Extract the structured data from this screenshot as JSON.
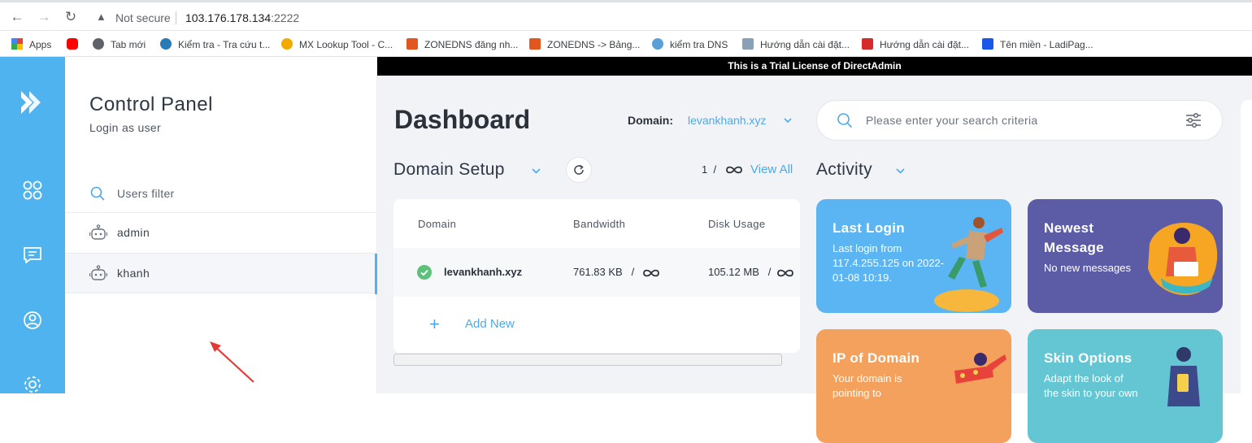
{
  "browser": {
    "security_text": "Not secure",
    "url_host": "103.176.178.134",
    "url_port": ":2222",
    "bookmarks": [
      {
        "label": "Apps",
        "color": "#e94235"
      },
      {
        "label": "",
        "color": "#ff0000"
      },
      {
        "label": "Tab mới",
        "color": "#5f6368"
      },
      {
        "label": "Kiểm tra - Tra cứu t...",
        "color": "#2a7ab8"
      },
      {
        "label": "MX Lookup Tool - C...",
        "color": "#f2a900"
      },
      {
        "label": "ZONEDNS đăng nh...",
        "color": "#e2561f"
      },
      {
        "label": "ZONEDNS -> Bảng...",
        "color": "#e2561f"
      },
      {
        "label": "kiểm tra DNS",
        "color": "#5aa0d8"
      },
      {
        "label": "Hướng dẫn cài đặt...",
        "color": "#8aa0b4"
      },
      {
        "label": "Hướng dẫn cài đặt...",
        "color": "#d62b2b"
      },
      {
        "label": "Tên miền - LadiPag...",
        "color": "#1a56e8"
      }
    ]
  },
  "sidebar": {
    "title": "Control Panel",
    "subtitle": "Login as user",
    "filter_placeholder": "Users filter",
    "users": [
      {
        "name": "admin",
        "active": false
      },
      {
        "name": "khanh",
        "active": true
      }
    ]
  },
  "main": {
    "trial_banner": "This is a Trial License of DirectAdmin",
    "page_title": "Dashboard",
    "domain_label": "Domain:",
    "domain_value": "levankhanh.xyz",
    "search_placeholder": "Please enter your search criteria",
    "domain_setup": {
      "heading": "Domain Setup",
      "count": "1",
      "count_sep": "/",
      "view_all": "View All",
      "columns": [
        "Domain",
        "Bandwidth",
        "Disk Usage"
      ],
      "rows": [
        {
          "domain": "levankhanh.xyz",
          "bandwidth": "761.83 KB",
          "disk": "105.12 MB"
        }
      ],
      "unlimited_sep": "/",
      "add_new": "Add New"
    },
    "activity": {
      "heading": "Activity",
      "tiles": [
        {
          "title": "Last Login",
          "desc_lines": [
            "Last login from",
            "117.4.255.125 on 2022-",
            "01-08 10:19."
          ],
          "color": "#5bb5f2"
        },
        {
          "title_lines": [
            "Newest",
            "Message"
          ],
          "desc_lines": [
            "No new messages"
          ],
          "color": "#5c5ca6"
        },
        {
          "title": "IP of Domain",
          "desc_lines": [
            "Your domain is",
            "pointing to"
          ],
          "color": "#f4a15d"
        },
        {
          "title": "Skin Options",
          "desc_lines": [
            "Adapt the look of",
            "the skin to your own"
          ],
          "color": "#63c6d2"
        }
      ]
    }
  },
  "colors": {
    "rail": "#4fb3f0",
    "accent": "#4fa9e8",
    "annotation_arrow": "#e53935"
  }
}
